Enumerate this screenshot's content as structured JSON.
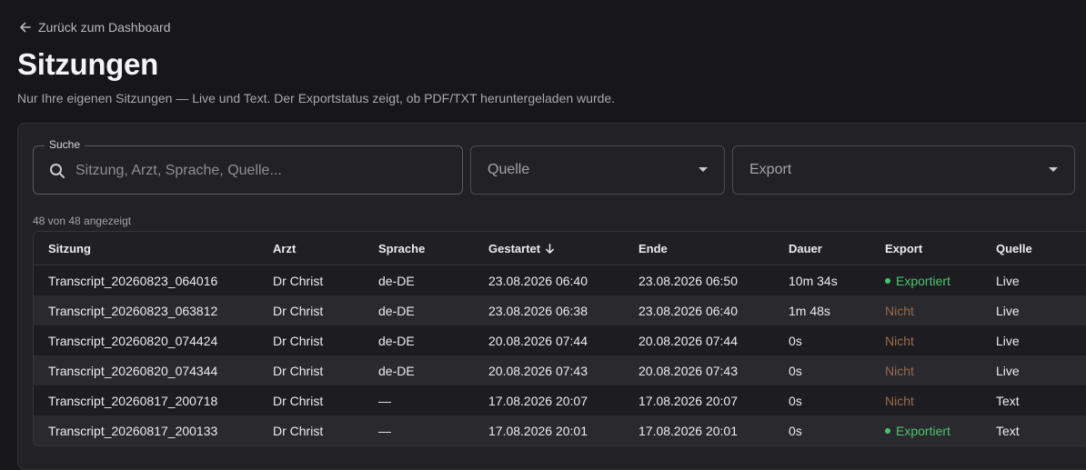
{
  "nav": {
    "back_label": "Zurück zum Dashboard"
  },
  "page": {
    "title": "Sitzungen",
    "subtitle": "Nur Ihre eigenen Sitzungen — Live und Text. Der Exportstatus zeigt, ob PDF/TXT heruntergeladen wurde."
  },
  "filters": {
    "search_legend": "Suche",
    "search_placeholder": "Sitzung, Arzt, Sprache, Quelle...",
    "search_value": "",
    "quelle_label": "Quelle",
    "export_label": "Export"
  },
  "count_label": "48 von 48 angezeigt",
  "table": {
    "columns": [
      "Sitzung",
      "Arzt",
      "Sprache",
      "Gestartet",
      "Ende",
      "Dauer",
      "Export",
      "Quelle"
    ],
    "sort_column": "Gestartet",
    "sort_direction": "descending",
    "rows": [
      {
        "sitzung": "Transcript_20260823_064016",
        "arzt": "Dr Christ",
        "sprache": "de-DE",
        "gestartet": "23.08.2026 06:40",
        "ende": "23.08.2026 06:50",
        "dauer": "10m 34s",
        "export": "Exportiert",
        "export_state": "exported",
        "quelle": "Live"
      },
      {
        "sitzung": "Transcript_20260823_063812",
        "arzt": "Dr Christ",
        "sprache": "de-DE",
        "gestartet": "23.08.2026 06:38",
        "ende": "23.08.2026 06:40",
        "dauer": "1m 48s",
        "export": "Nicht",
        "export_state": "not",
        "quelle": "Live"
      },
      {
        "sitzung": "Transcript_20260820_074424",
        "arzt": "Dr Christ",
        "sprache": "de-DE",
        "gestartet": "20.08.2026 07:44",
        "ende": "20.08.2026 07:44",
        "dauer": "0s",
        "export": "Nicht",
        "export_state": "not",
        "quelle": "Live"
      },
      {
        "sitzung": "Transcript_20260820_074344",
        "arzt": "Dr Christ",
        "sprache": "de-DE",
        "gestartet": "20.08.2026 07:43",
        "ende": "20.08.2026 07:43",
        "dauer": "0s",
        "export": "Nicht",
        "export_state": "not",
        "quelle": "Live"
      },
      {
        "sitzung": "Transcript_20260817_200718",
        "arzt": "Dr Christ",
        "sprache": "—",
        "gestartet": "17.08.2026 20:07",
        "ende": "17.08.2026 20:07",
        "dauer": "0s",
        "export": "Nicht",
        "export_state": "not",
        "quelle": "Text"
      },
      {
        "sitzung": "Transcript_20260817_200133",
        "arzt": "Dr Christ",
        "sprache": "—",
        "gestartet": "17.08.2026 20:01",
        "ende": "17.08.2026 20:01",
        "dauer": "0s",
        "export": "Exportiert",
        "export_state": "exported",
        "quelle": "Text"
      }
    ]
  },
  "colors": {
    "background": "#17171a",
    "card": "#222226",
    "exported": "#4cc46e",
    "not_exported": "#9a6a4c"
  }
}
